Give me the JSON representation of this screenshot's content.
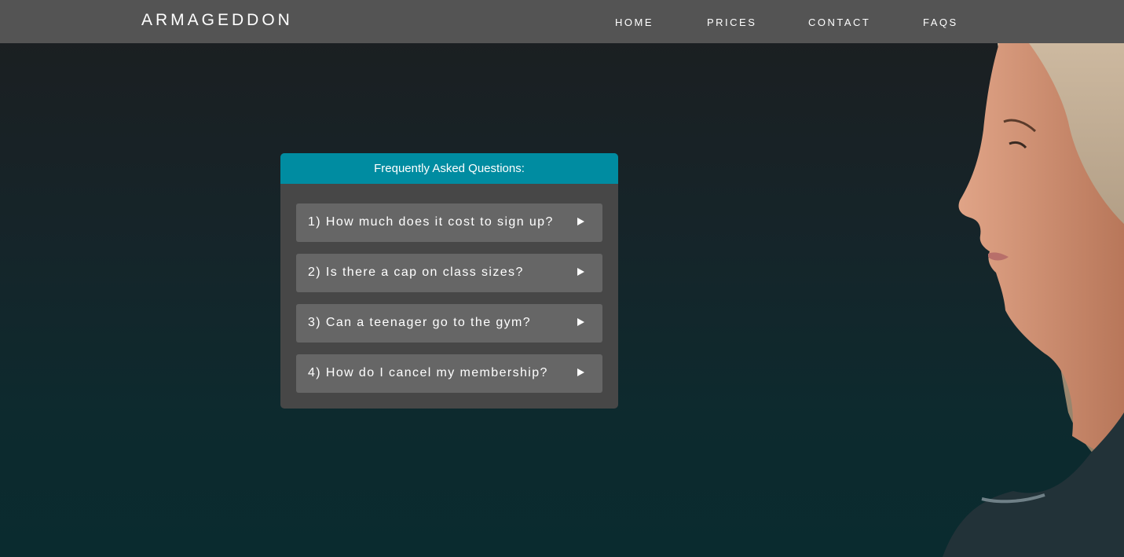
{
  "header": {
    "logo": "ARMAGEDDON",
    "nav": [
      {
        "label": "HOME"
      },
      {
        "label": "PRICES"
      },
      {
        "label": "CONTACT"
      },
      {
        "label": "FAQS"
      }
    ]
  },
  "faq": {
    "title": "Frequently Asked Questions:",
    "items": [
      {
        "question": "1) How much does it cost to sign up?",
        "icon": "play-arrow-icon"
      },
      {
        "question": "2) Is there a cap on class sizes?",
        "icon": "play-arrow-icon"
      },
      {
        "question": "3) Can a teenager go to the gym?",
        "icon": "play-arrow-icon"
      },
      {
        "question": "4) How do I cancel my membership?",
        "icon": "play-arrow-icon"
      }
    ]
  },
  "colors": {
    "header_bg": "#545454",
    "accent": "#008ca1",
    "panel_bg": "#474747",
    "item_bg": "#666666"
  }
}
